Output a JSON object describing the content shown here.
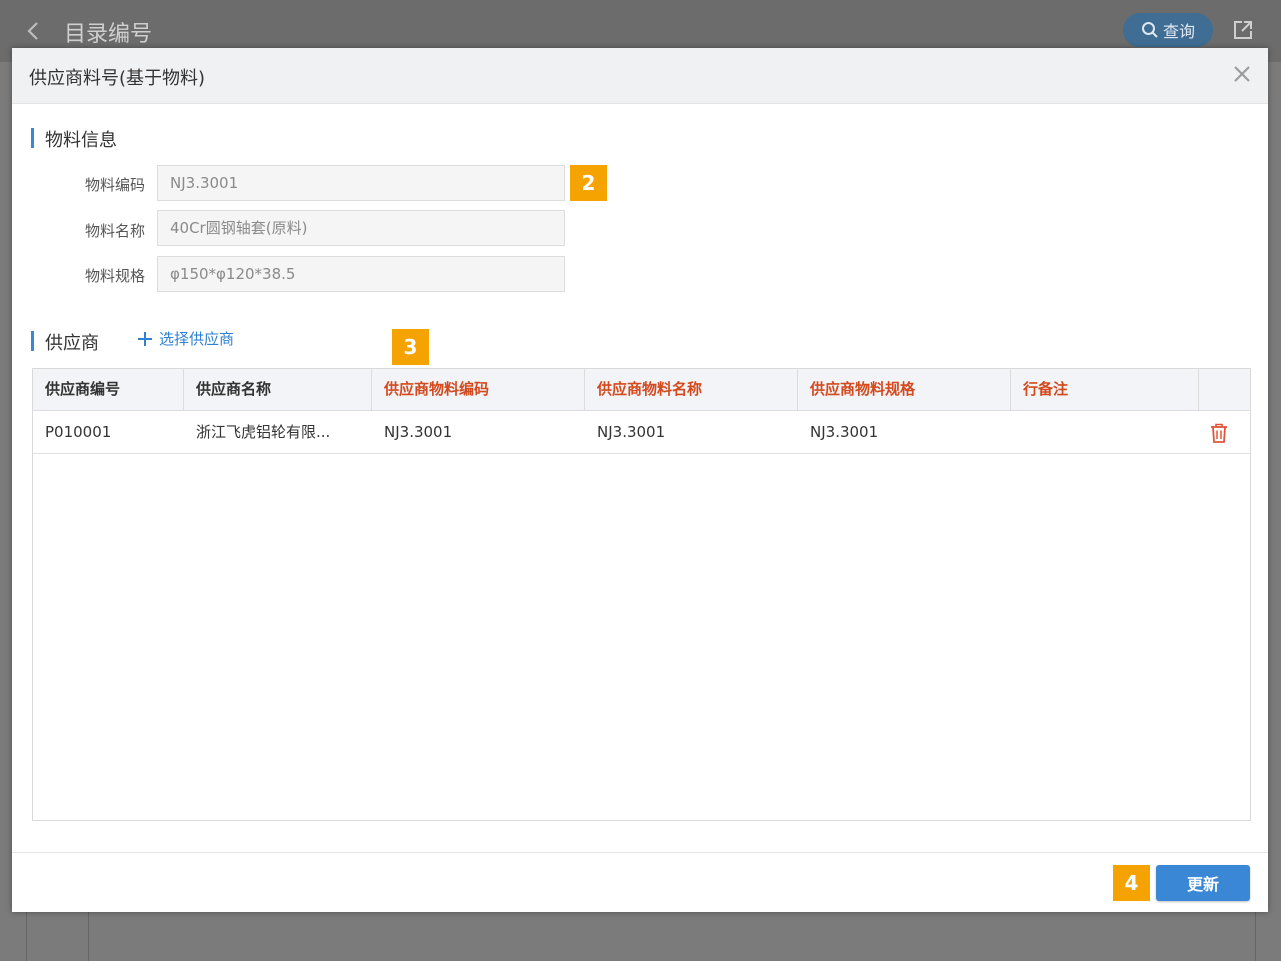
{
  "background": {
    "title": "目录编号",
    "search_label": "查询"
  },
  "modal": {
    "title": "供应商料号(基于物料)",
    "material_section": {
      "title": "物料信息",
      "fields": [
        {
          "label": "物料编码",
          "value": "NJ3.3001"
        },
        {
          "label": "物料名称",
          "value": "40Cr圆钢轴套(原料)"
        },
        {
          "label": "物料规格",
          "value": "φ150*φ120*38.5"
        }
      ]
    },
    "supplier_section": {
      "title": "供应商",
      "add_label": "选择供应商"
    },
    "table": {
      "columns": [
        "供应商编号",
        "供应商名称",
        "供应商物料编码",
        "供应商物料名称",
        "供应商物料规格",
        "行备注"
      ],
      "rows": [
        [
          "P010001",
          "浙江飞虎铝轮有限...",
          "NJ3.3001",
          "NJ3.3001",
          "NJ3.3001",
          ""
        ]
      ]
    },
    "update_label": "更新"
  },
  "callouts": [
    "2",
    "3",
    "4"
  ],
  "colors": {
    "accent": "#3a87d6",
    "required_header": "#d44a1f",
    "callout": "#f5a300"
  }
}
